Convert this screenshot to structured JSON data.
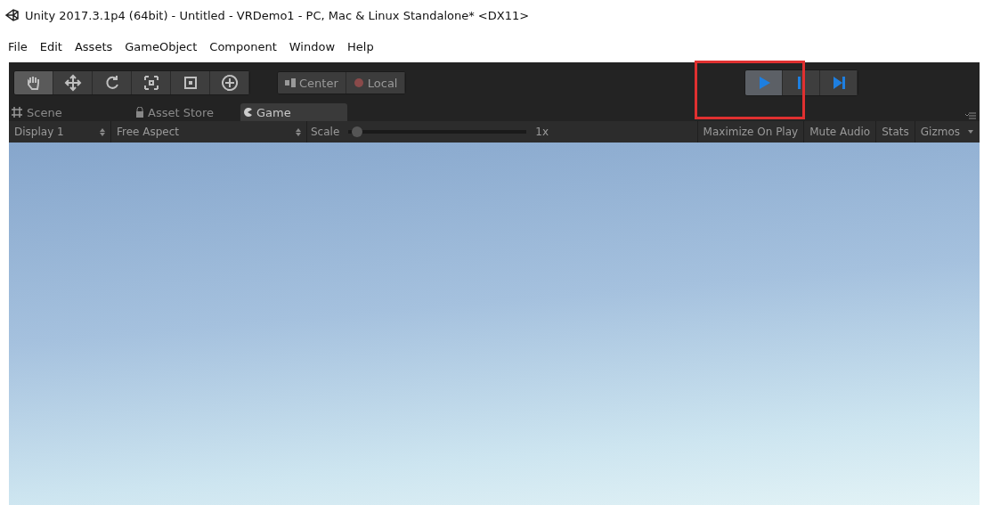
{
  "window": {
    "title": "Unity 2017.3.1p4 (64bit) - Untitled - VRDemo1 - PC, Mac & Linux Standalone* <DX11>"
  },
  "menu": [
    "File",
    "Edit",
    "Assets",
    "GameObject",
    "Component",
    "Window",
    "Help"
  ],
  "tools": [
    {
      "kind": "hand",
      "selected": true
    },
    {
      "kind": "move",
      "selected": false
    },
    {
      "kind": "rotate",
      "selected": false
    },
    {
      "kind": "scale",
      "selected": false
    },
    {
      "kind": "rect",
      "selected": false
    },
    {
      "kind": "transform",
      "selected": false
    }
  ],
  "pivot": [
    {
      "kind": "center",
      "label": "Center"
    },
    {
      "kind": "local",
      "label": "Local"
    }
  ],
  "playback": [
    {
      "kind": "play",
      "selected": true
    },
    {
      "kind": "pause",
      "selected": false
    },
    {
      "kind": "step",
      "selected": false
    }
  ],
  "tabs": [
    {
      "kind": "scene",
      "label": "Scene",
      "selected": false
    },
    {
      "kind": "store",
      "label": "Asset Store",
      "selected": false
    },
    {
      "kind": "game",
      "label": "Game",
      "selected": true
    }
  ],
  "game_toolbar": {
    "display": "Display 1",
    "aspect": "Free Aspect",
    "scale_label": "Scale",
    "scale": {
      "level": 0.02
    },
    "scale_reading": "1x",
    "toggles": [
      {
        "label": "Maximize On Play",
        "on": false
      },
      {
        "label": "Mute Audio",
        "on": false
      },
      {
        "label": "Stats",
        "on": false
      },
      {
        "label": "Gizmos",
        "on": false
      }
    ]
  }
}
